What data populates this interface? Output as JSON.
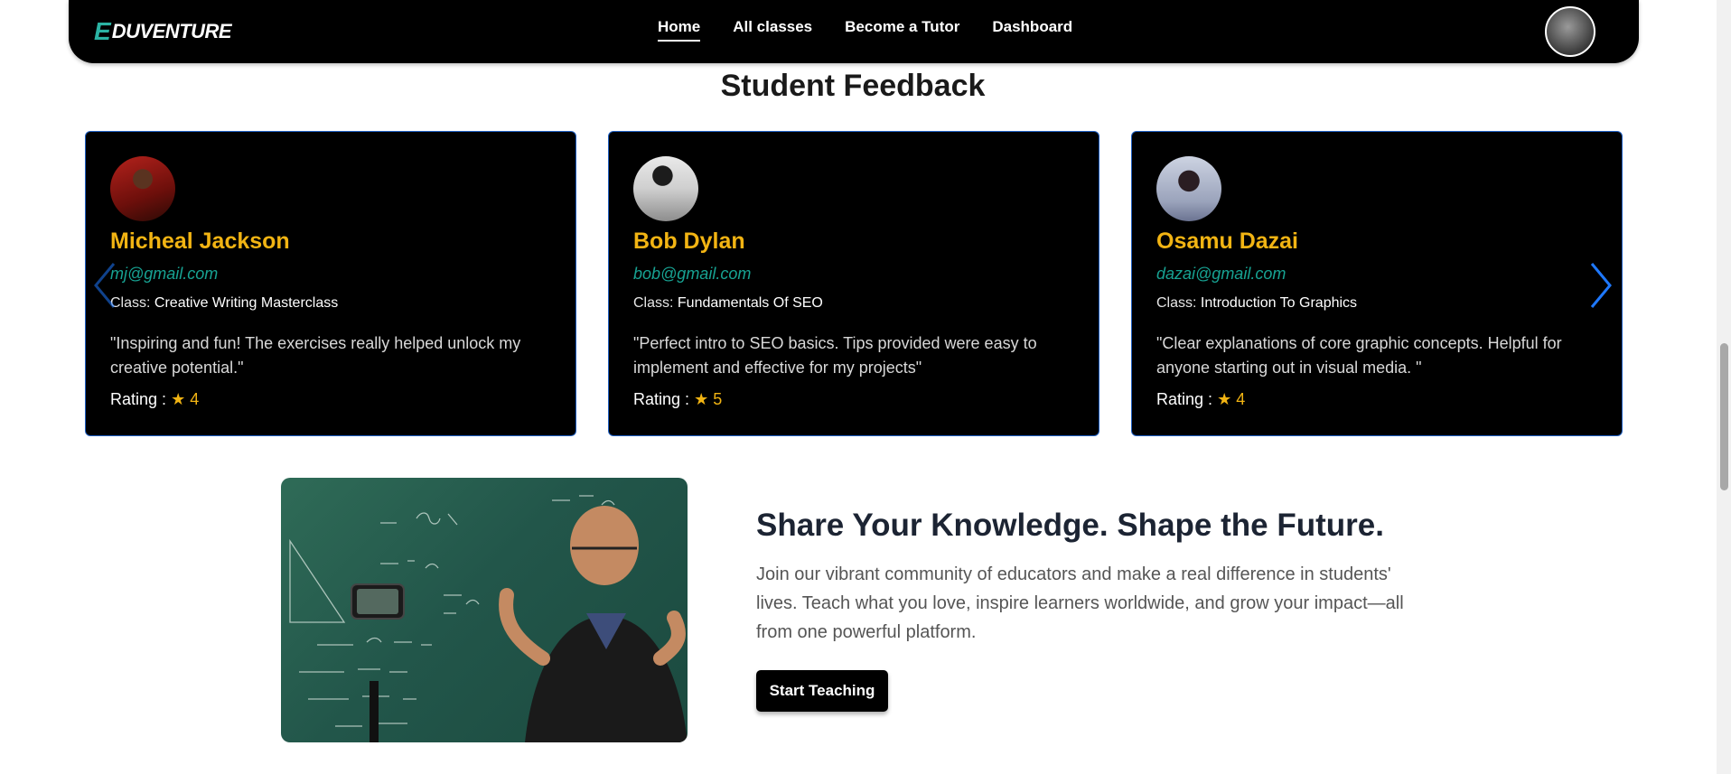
{
  "brand": {
    "logo_letter": "E",
    "logo_text": "DUVENTURE"
  },
  "nav": {
    "items": [
      "Home",
      "All classes",
      "Become a Tutor",
      "Dashboard"
    ],
    "active": "Home"
  },
  "feedback": {
    "title": "Student Feedback",
    "class_label": "Class:",
    "rating_label": "Rating :",
    "star": "★",
    "cards": [
      {
        "name": "Micheal Jackson",
        "email": "mj@gmail.com",
        "class_name": "Creative Writing Masterclass",
        "quote": "\"Inspiring and fun! The exercises really helped unlock my creative potential.\"",
        "rating": 4
      },
      {
        "name": "Bob Dylan",
        "email": "bob@gmail.com",
        "class_name": "Fundamentals Of SEO",
        "quote": "\"Perfect intro to SEO basics. Tips provided were easy to implement and effective for my projects\"",
        "rating": 5
      },
      {
        "name": "Osamu Dazai",
        "email": "dazai@gmail.com",
        "class_name": "Introduction To Graphics",
        "quote": "\"Clear explanations of core graphic concepts. Helpful for anyone starting out in visual media. \"",
        "rating": 4
      }
    ]
  },
  "teach": {
    "title": "Share Your Knowledge. Shape the Future.",
    "text": "Join our vibrant community of educators and make a real difference in students' lives. Teach what you love, inspire learners worldwide, and grow your impact—all from one powerful platform.",
    "button": "Start Teaching"
  },
  "colors": {
    "accent_yellow": "#f2b413",
    "accent_teal": "#17a393",
    "card_border": "#1f5fc2",
    "arrow_blue": "#1e78ff"
  },
  "icons": {
    "prev": "chevron-left-icon",
    "next": "chevron-right-icon",
    "star": "star-icon"
  }
}
